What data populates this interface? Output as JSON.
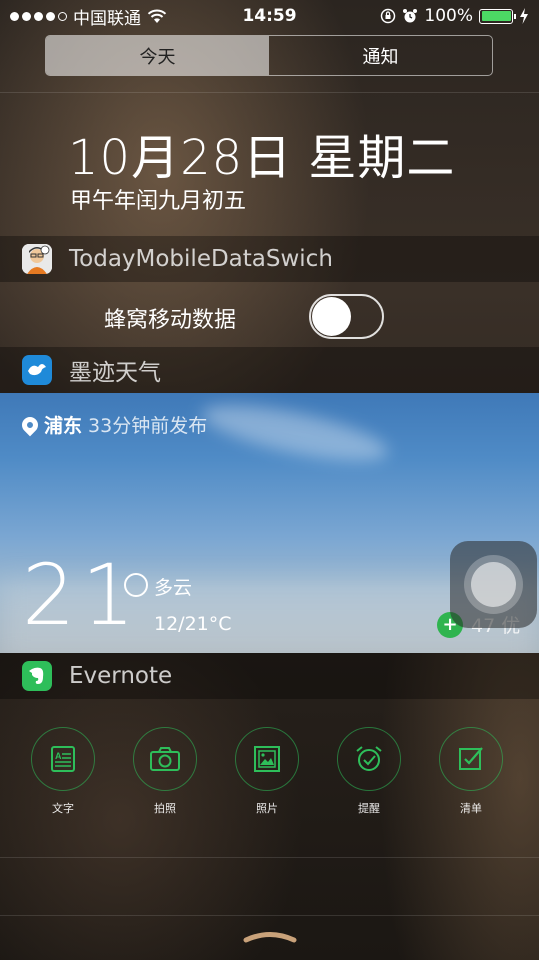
{
  "status_bar": {
    "carrier": "中国联通",
    "time": "14:59",
    "battery_percent": "100%",
    "battery_level": 1.0
  },
  "tabs": [
    {
      "label": "今天",
      "active": true
    },
    {
      "label": "通知",
      "active": false
    }
  ],
  "date": {
    "gregorian": "10月28日 星期二",
    "lunar": "甲午年闰九月初五"
  },
  "widgets": {
    "data_switch": {
      "title": "TodayMobileDataSwich",
      "toggle_label": "蜂窝移动数据",
      "toggle_on": false
    },
    "weather": {
      "title": "墨迹天气",
      "location": "浦东",
      "published": "33分钟前发布",
      "temperature": "21",
      "condition": "多云",
      "range": "12/21°C",
      "aqi": "47 优",
      "aqi_badge": "+"
    },
    "evernote": {
      "title": "Evernote",
      "actions": [
        {
          "label": "文字",
          "icon": "text-note-icon"
        },
        {
          "label": "拍照",
          "icon": "camera-icon"
        },
        {
          "label": "照片",
          "icon": "photo-icon"
        },
        {
          "label": "提醒",
          "icon": "alarm-clock-icon"
        },
        {
          "label": "清单",
          "icon": "checklist-icon"
        }
      ]
    }
  },
  "colors": {
    "evernote_green": "#2ebe5a",
    "weather_blue": "#1f8ad9",
    "battery_green": "#4cd964"
  }
}
